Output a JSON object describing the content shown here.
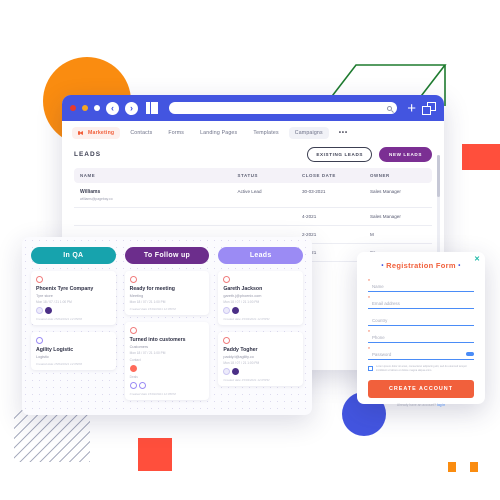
{
  "decorations": {
    "orange_circle": "#FA8C10",
    "green_plane": "#1E7B2F",
    "red_accent": "#FF4F3C",
    "blue_circle": "#4355E0"
  },
  "browser": {
    "traffic_lights": [
      "red",
      "amber",
      "white"
    ],
    "back_icon": "chevron-left-icon",
    "forward_icon": "chevron-right-icon",
    "layout_icon": "layout-icon",
    "search_placeholder": "",
    "search_icon": "search-icon",
    "plus_label": "+",
    "windows_icon": "copy-windows-icon",
    "nav": {
      "brand": "Marketing",
      "items": [
        {
          "label": "Contacts",
          "active": false
        },
        {
          "label": "Forms",
          "active": false
        },
        {
          "label": "Landing Pages",
          "active": false
        },
        {
          "label": "Templates",
          "active": false
        },
        {
          "label": "Campaigns",
          "active": true
        }
      ],
      "overflow": "•••"
    },
    "page": {
      "title": "LEADS",
      "existing_button": "EXISTING LEADS",
      "new_button": "NEW LEADS",
      "accent": "#7B2F93"
    },
    "table": {
      "columns": [
        "NAME",
        "STATUS",
        "CLOSE DATE",
        "OWNER"
      ],
      "rows": [
        {
          "name": "Williams",
          "email": "williams@pagebay.co",
          "status": "Active Lead",
          "close_date": "30-03-2021",
          "owner": "Sales Manager"
        },
        {
          "name": "",
          "email": "",
          "status": "",
          "close_date": "4-2021",
          "owner": "Sales Manager"
        },
        {
          "name": "",
          "email": "",
          "status": "",
          "close_date": "2-2021",
          "owner": "M"
        },
        {
          "name": "",
          "email": "",
          "status": "",
          "close_date": "3-2021",
          "owner": "Sa"
        }
      ]
    }
  },
  "kanban": {
    "columns": [
      {
        "title": "In QA",
        "color": "#17A3AD",
        "cards": [
          {
            "title": "Phoenix Tyre Company",
            "subtitle": "Tyre store",
            "date": "Mon 18 / 07 / 21 1:00 PM",
            "footer": "Created date 15/04/2021 12:05PM",
            "avatars": [
              "light",
              "dark"
            ]
          },
          {
            "title": "Agility Logistic",
            "subtitle": "Logistic",
            "date": "",
            "footer": "Created date 15/04/2021 12:05PM",
            "avatars": []
          }
        ]
      },
      {
        "title": "To Follow up",
        "color": "#6C2D8C",
        "cards": [
          {
            "title": "Ready for meeting",
            "subtitle": "Meeting",
            "date": "Mon 18 / 07 / 21 1:00 PM",
            "footer": "Created date 15/04/2021 12:05PM",
            "avatars": []
          },
          {
            "title": "Turned into customers",
            "subtitle": "Customers",
            "date": "Mon 18 / 07 / 21 1:00 PM",
            "label_contact": "Contact",
            "label_deals": "Deals",
            "footer": "Created date 15/04/2021 12:05PM",
            "avatars": [
              "red",
              "ring",
              "ring"
            ]
          }
        ]
      },
      {
        "title": "Leads",
        "color": "#9B8BF4",
        "cards": [
          {
            "title": "Gareth Jackson",
            "subtitle": "gareth.j@phoenix.com",
            "date": "Mon 18 / 07 / 21 1:00 PM",
            "footer": "Created date 15/04/2021 12:05PM",
            "avatars": [
              "light",
              "dark"
            ]
          },
          {
            "title": "Paddy Togher",
            "subtitle": "paddy.t@agility.co",
            "date": "Mon 18 / 07 / 21 1:00 PM",
            "footer": "Created date 15/04/2021 12:05PM",
            "avatars": [
              "light",
              "dark"
            ]
          }
        ]
      }
    ]
  },
  "registration_form": {
    "title": "Registration Form",
    "bullet": "•",
    "close_icon": "close-icon",
    "accent": "#F1603C",
    "underline_color": "#4A8CF7",
    "fields": [
      {
        "placeholder": "Name",
        "required": true
      },
      {
        "placeholder": "Email address",
        "required": true
      },
      {
        "placeholder": "Country",
        "required": false
      },
      {
        "placeholder": "Phone",
        "required": true
      },
      {
        "placeholder": "Password",
        "required": true,
        "toggle_icon": "eye-icon"
      }
    ],
    "consent_text": "Lorem ipsum dolor sit amet, consectetur adipiscing elit, sed do eiusmod tempor incididunt ut labore et dolore magna aliqua enim.",
    "submit_label": "CREATE ACCOUNT",
    "footer_text": "Already have an account?",
    "footer_link": "log in"
  }
}
